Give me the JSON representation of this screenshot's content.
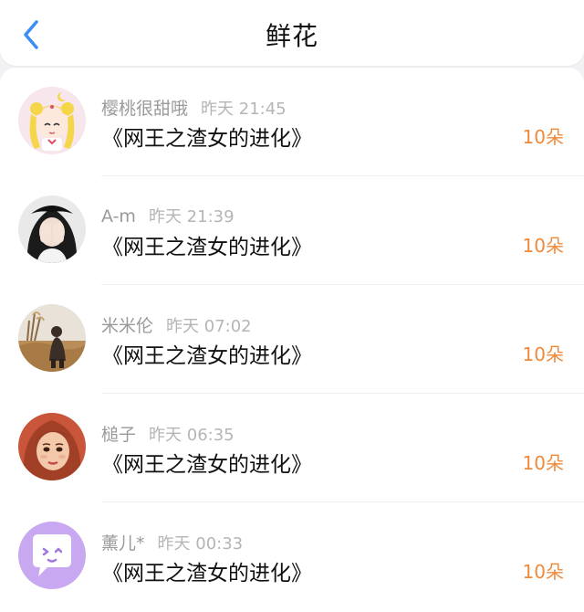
{
  "header": {
    "title": "鲜花",
    "back_icon": "chevron-left-icon",
    "accent_color": "#3a8ef6"
  },
  "items": [
    {
      "name": "樱桃很甜哦",
      "time": "昨天 21:45",
      "work": "《网王之渣女的进化》",
      "amount": "10朵",
      "avatar": "sailor-moon-avatar"
    },
    {
      "name": "A-m",
      "time": "昨天 21:39",
      "work": "《网王之渣女的进化》",
      "amount": "10朵",
      "avatar": "girl-covering-face-avatar"
    },
    {
      "name": "米米伦",
      "time": "昨天 07:02",
      "work": "《网王之渣女的进化》",
      "amount": "10朵",
      "avatar": "field-boy-avatar"
    },
    {
      "name": "槌子",
      "time": "昨天 06:35",
      "work": "《网王之渣女的进化》",
      "amount": "10朵",
      "avatar": "painted-girl-avatar"
    },
    {
      "name": "薰儿*",
      "time": "昨天 00:33",
      "work": "《网王之渣女的进化》",
      "amount": "10朵",
      "avatar": "chat-bubble-avatar"
    }
  ],
  "colors": {
    "amount": "#f08a3b",
    "name": "#9a9a9a",
    "time": "#b5b5b5"
  }
}
